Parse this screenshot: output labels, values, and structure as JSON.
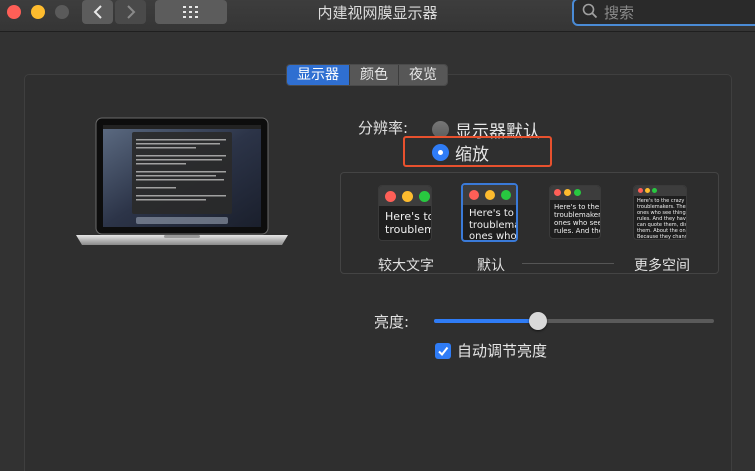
{
  "window": {
    "title": "内建视网膜显示器",
    "search_placeholder": "搜索"
  },
  "tabs": [
    {
      "label": "显示器",
      "active": true
    },
    {
      "label": "颜色",
      "active": false
    },
    {
      "label": "夜览",
      "active": false
    }
  ],
  "resolution": {
    "label": "分辨率:",
    "options": [
      {
        "label": "显示器默认",
        "selected": false
      },
      {
        "label": "缩放",
        "selected": true
      }
    ]
  },
  "scaling": {
    "options": [
      {
        "label": "较大文字",
        "preview": "Here's to\ntroublem",
        "selected": false
      },
      {
        "label": "默认",
        "preview": "Here's to t\ntroublema\nones who",
        "selected": true
      },
      {
        "label": "",
        "preview": "Here's to the c\ntroublemakers.\nones who see t\nrules. And they",
        "selected": false
      },
      {
        "label": "更多空间",
        "preview": "Here's to the crazy\ntroublemakers. The rou\nones who see things dif\nrules. And they have no\ncan quote them, disagre\nthem. About the only thi\nBecause they change th",
        "selected": false
      }
    ]
  },
  "brightness": {
    "label": "亮度:",
    "value": 0.37,
    "auto_adjust_label": "自动调节亮度",
    "auto_adjust": true
  },
  "colors": {
    "accent": "#2f7cf6",
    "highlight": "#e8512e"
  }
}
